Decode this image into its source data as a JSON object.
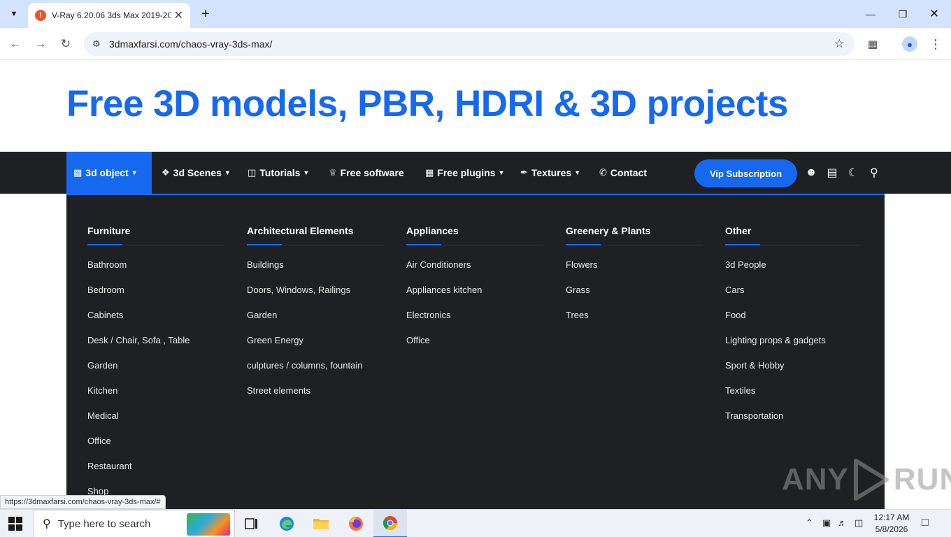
{
  "browser": {
    "tab_title": "V-Ray 6.20.06 3ds Max 2019-20",
    "url": "3dmaxfarsi.com/chaos-vray-3ds-max/",
    "status_url": "https://3dmaxfarsi.com/chaos-vray-3ds-max/#"
  },
  "hero": {
    "title": "Free 3D models, PBR, HDRI & 3D projects"
  },
  "nav": {
    "items": [
      {
        "label": "3d object",
        "icon": "sofa-icon"
      },
      {
        "label": "3d Scenes",
        "icon": "cube-icon"
      },
      {
        "label": "Tutorials",
        "icon": "book-icon"
      },
      {
        "label": "Free software",
        "icon": "crown-icon"
      },
      {
        "label": "Free plugins",
        "icon": "grid-icon"
      },
      {
        "label": "Textures",
        "icon": "brush-icon"
      },
      {
        "label": "Contact",
        "icon": "phone-icon"
      }
    ],
    "vip_label": "Vip Subscription"
  },
  "mega_menu": {
    "columns": [
      {
        "heading": "Furniture",
        "items": [
          "Bathroom",
          "Bedroom",
          "Cabinets",
          "Desk / Chair, Sofa , Table",
          "Garden",
          "Kitchen",
          "Medical",
          "Office",
          "Restaurant",
          "Shop"
        ]
      },
      {
        "heading": "Architectural Elements",
        "items": [
          "Buildings",
          "Doors, Windows, Railings",
          "Garden",
          "Green Energy",
          "culptures / columns, fountain",
          "Street elements"
        ]
      },
      {
        "heading": "Appliances",
        "items": [
          "Air Conditioners",
          "Appliances kitchen",
          "Electronics",
          "Office"
        ]
      },
      {
        "heading": "Greenery & Plants",
        "items": [
          "Flowers",
          "Grass",
          "Trees"
        ]
      },
      {
        "heading": "Other",
        "items": [
          "3d People",
          "Cars",
          "Food",
          "Lighting props & gadgets",
          "Sport & Hobby",
          "Textiles",
          "Transportation"
        ]
      }
    ]
  },
  "watermark": {
    "left": "ANY",
    "right": "RUN"
  },
  "taskbar": {
    "search_placeholder": "Type here to search",
    "time": "12:17 AM",
    "date": "5/8/2026"
  },
  "colors": {
    "accent": "#1669ef",
    "nav_bg": "#1f2024"
  }
}
